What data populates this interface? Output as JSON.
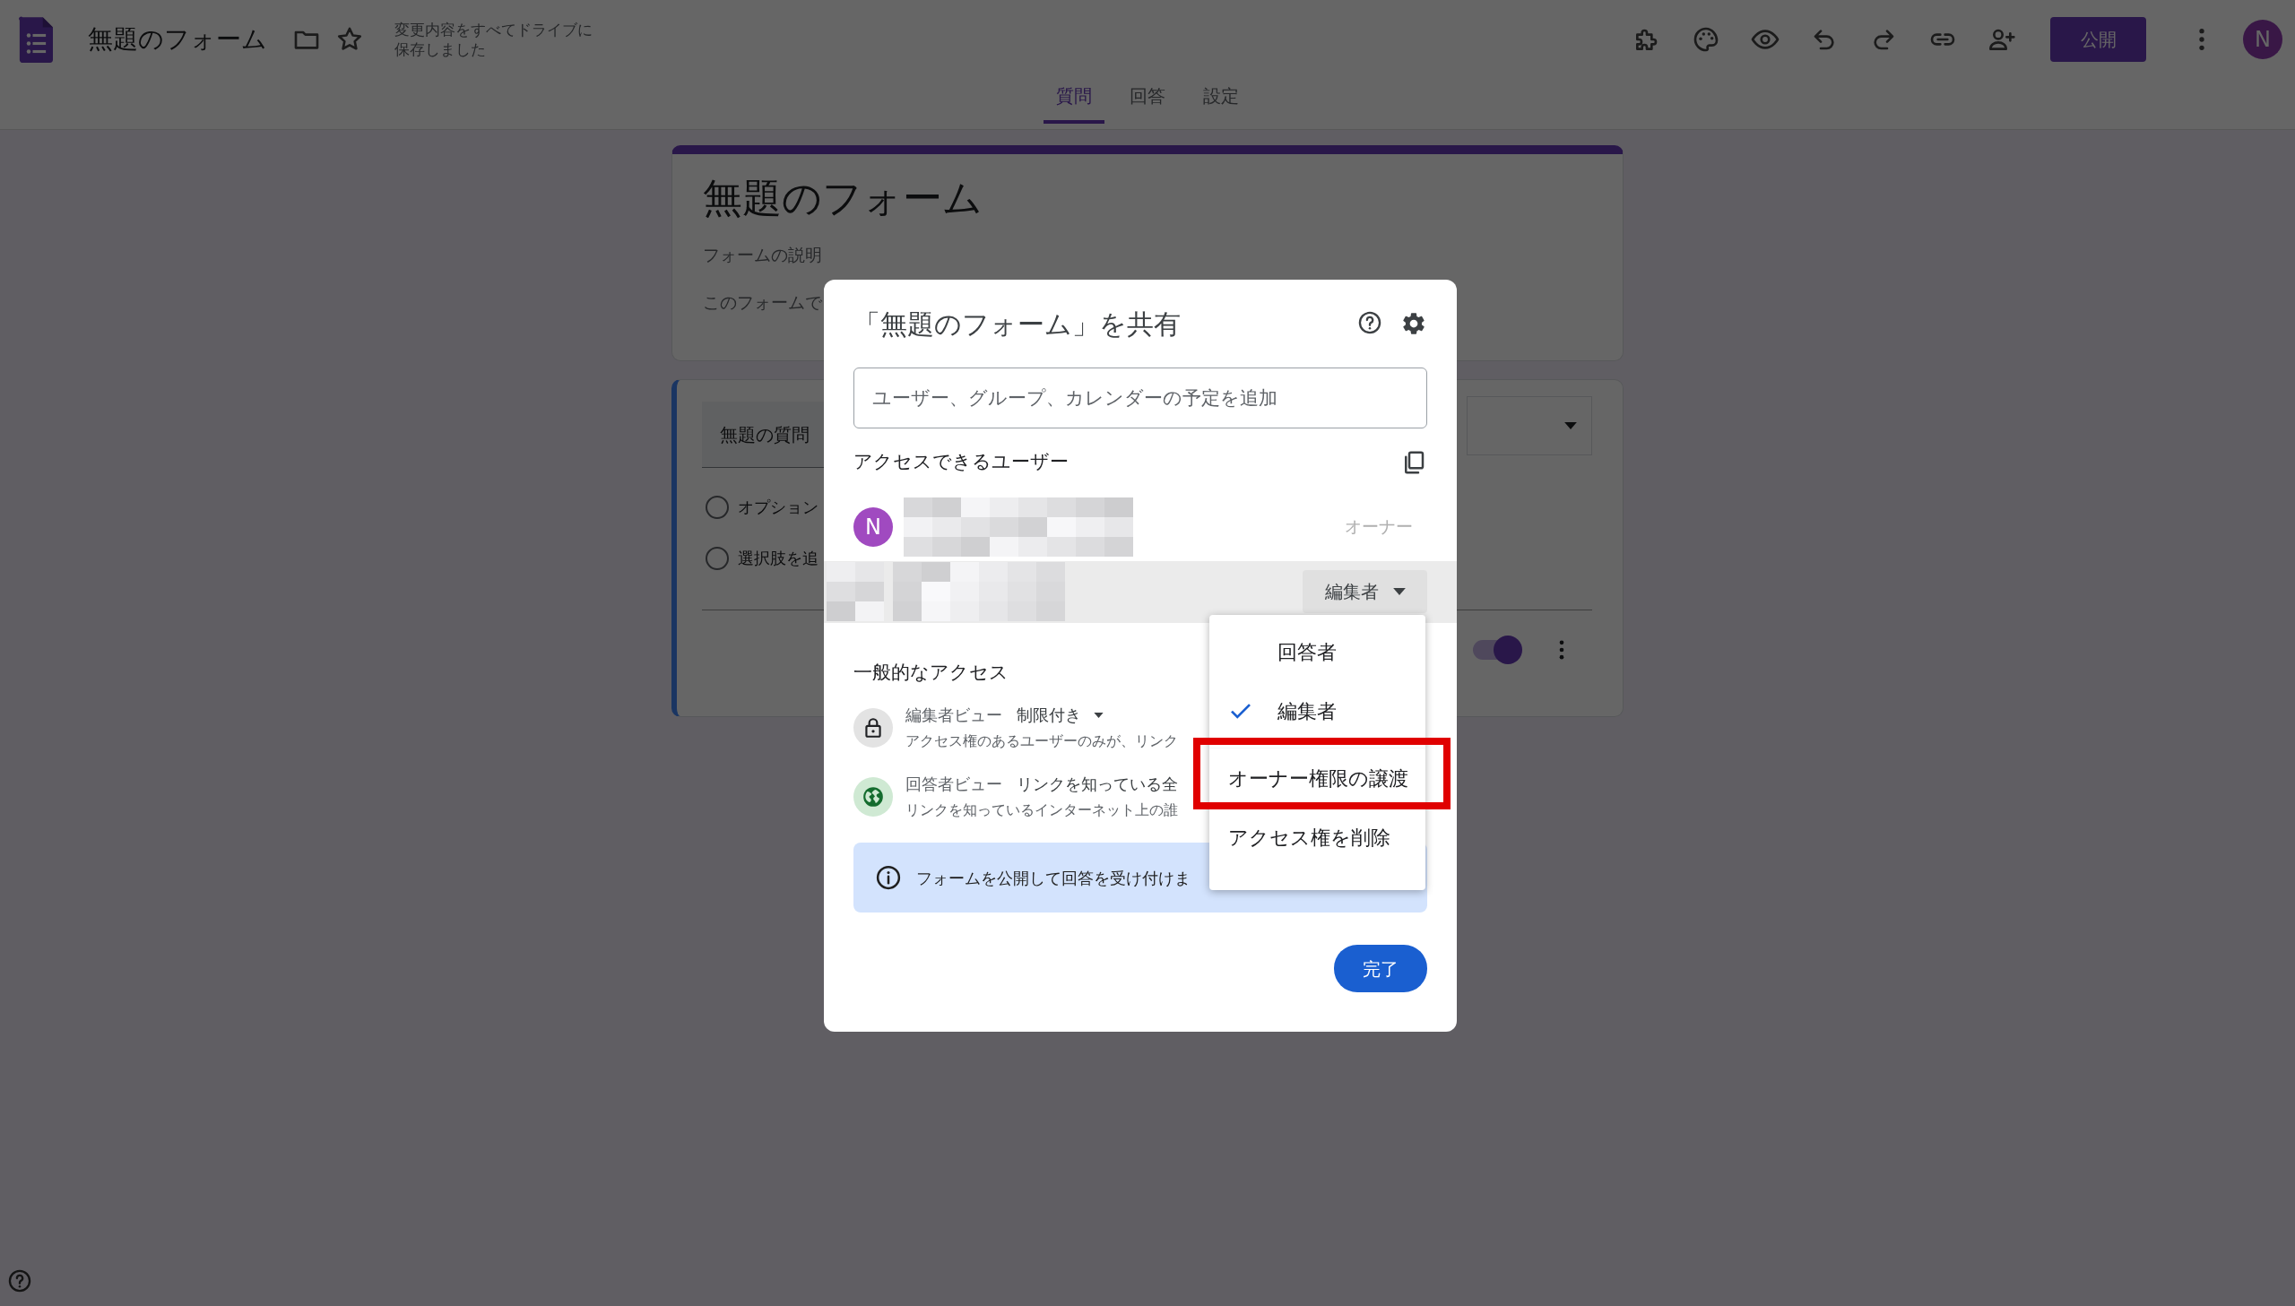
{
  "app_bar": {
    "title": "無題のフォーム",
    "save_status": "変更内容をすべてドライブに保存しました",
    "publish_button": "公開",
    "avatar": "N"
  },
  "tabs": [
    {
      "label": "質問",
      "selected": true
    },
    {
      "label": "回答",
      "selected": false
    },
    {
      "label": "設定",
      "selected": false
    }
  ],
  "form": {
    "title": "無題のフォーム",
    "description": "フォームの説明",
    "note": "このフォームで",
    "question": {
      "title": "無題の質問",
      "options": [
        {
          "label": "オプション",
          "selected": false
        },
        {
          "label": "選択肢を追",
          "selected": false
        }
      ],
      "required": {
        "on": true
      }
    }
  },
  "share_dialog": {
    "title": "「無題のフォーム」を共有",
    "add_people": {
      "placeholder": "ユーザー、グループ、カレンダーの予定を追加"
    },
    "people_heading": "アクセスできるユーザー",
    "people": [
      {
        "kind": "owner",
        "avatar": "N",
        "role": "オーナー"
      },
      {
        "kind": "editor",
        "role": "編集者"
      }
    ],
    "general_access_heading": "一般的なアクセス",
    "general_access": [
      {
        "kind": "lock",
        "view": "編集者ビュー",
        "setting": "制限付き",
        "has_dropdown": true,
        "description": "アクセス権のあるユーザーのみが、リンク"
      },
      {
        "kind": "globe",
        "view": "回答者ビュー",
        "setting": "リンクを知っている全",
        "description": "リンクを知っているインターネット上の誰"
      }
    ],
    "info_banner": "フォームを公開して回答を受け付けま",
    "done_button": "完了"
  },
  "role_menu": [
    {
      "kind": "role",
      "label": "回答者",
      "selected": false,
      "highlighted": false
    },
    {
      "kind": "role",
      "label": "編集者",
      "selected": true,
      "highlighted": false
    },
    {
      "kind": "action",
      "label": "オーナー権限の譲渡",
      "highlighted": true
    },
    {
      "kind": "action",
      "label": "アクセス権を削除",
      "highlighted": false
    }
  ]
}
